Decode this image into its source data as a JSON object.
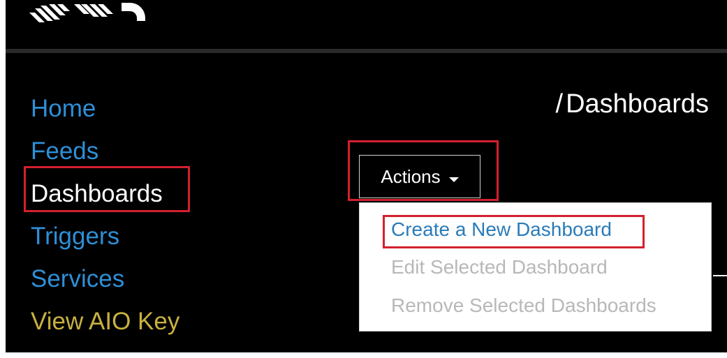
{
  "nav": {
    "items": [
      {
        "label": "Home",
        "state": "link"
      },
      {
        "label": "Feeds",
        "state": "link"
      },
      {
        "label": "Dashboards",
        "state": "active"
      },
      {
        "label": "Triggers",
        "state": "link"
      },
      {
        "label": "Services",
        "state": "link"
      },
      {
        "label": "View AIO Key",
        "state": "key"
      }
    ]
  },
  "breadcrumb": {
    "separator": "/",
    "current": "Dashboards"
  },
  "actions": {
    "label": "Actions",
    "menu": [
      {
        "label": "Create a New Dashboard",
        "enabled": true
      },
      {
        "label": "Edit Selected Dashboard",
        "enabled": false
      },
      {
        "label": "Remove Selected Dashboards",
        "enabled": false
      }
    ]
  },
  "colors": {
    "background": "#000000",
    "link": "#2e8fd6",
    "active": "#ffffff",
    "key": "#c8b13f",
    "menu_link": "#2a7bb8",
    "menu_disabled": "#b8b8b8",
    "annotation": "#d3202e"
  }
}
